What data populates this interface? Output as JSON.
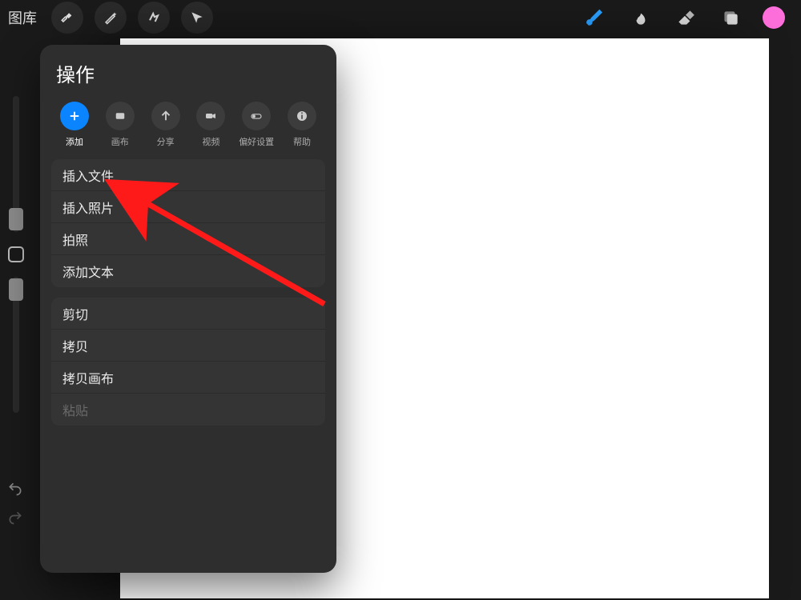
{
  "topbar": {
    "gallery_label": "图库",
    "left_tools": [
      "wrench",
      "magic",
      "select",
      "move"
    ],
    "right_tools": [
      "brush",
      "smudge",
      "eraser",
      "layers"
    ],
    "current_color": "#ff6fdc"
  },
  "panel": {
    "title": "操作",
    "tabs": [
      {
        "id": "add",
        "label": "添加",
        "icon": "plus",
        "active": true
      },
      {
        "id": "canvas",
        "label": "画布",
        "icon": "rect",
        "active": false
      },
      {
        "id": "share",
        "label": "分享",
        "icon": "up",
        "active": false
      },
      {
        "id": "video",
        "label": "视频",
        "icon": "camera",
        "active": false
      },
      {
        "id": "prefs",
        "label": "偏好设置",
        "icon": "toggle",
        "active": false
      },
      {
        "id": "help",
        "label": "帮助",
        "icon": "info",
        "active": false
      }
    ],
    "groups": [
      {
        "items": [
          {
            "id": "insert-file",
            "label": "插入文件",
            "disabled": false
          },
          {
            "id": "insert-photo",
            "label": "插入照片",
            "disabled": false
          },
          {
            "id": "take-photo",
            "label": "拍照",
            "disabled": false
          },
          {
            "id": "add-text",
            "label": "添加文本",
            "disabled": false
          }
        ]
      },
      {
        "items": [
          {
            "id": "cut",
            "label": "剪切",
            "disabled": false
          },
          {
            "id": "copy",
            "label": "拷贝",
            "disabled": false
          },
          {
            "id": "copy-canvas",
            "label": "拷贝画布",
            "disabled": false
          },
          {
            "id": "paste",
            "label": "粘贴",
            "disabled": true
          }
        ]
      }
    ]
  }
}
